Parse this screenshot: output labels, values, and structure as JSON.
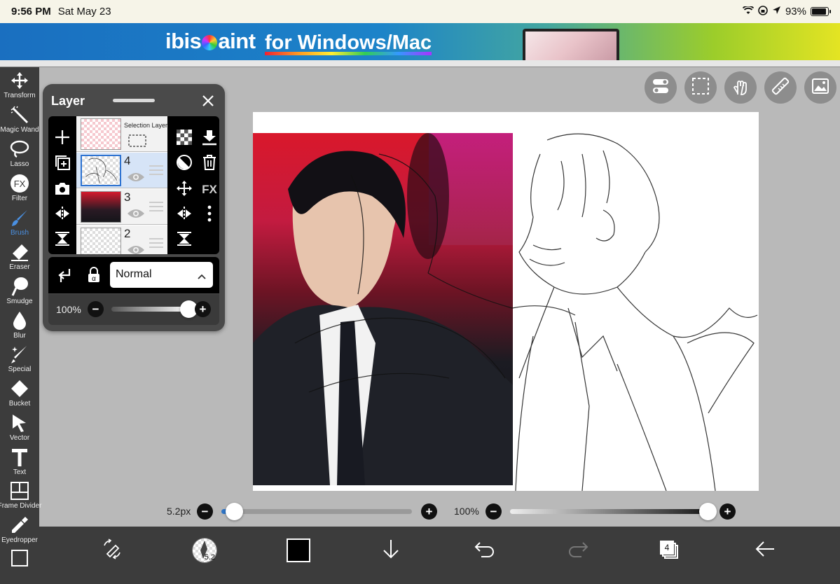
{
  "status_bar": {
    "time": "9:56 PM",
    "date": "Sat May 23",
    "battery": "93%",
    "battery_level": 0.93
  },
  "ad": {
    "brand_pre": "ibis",
    "brand_post": "aint",
    "subtitle": "for Windows/Mac"
  },
  "tools": [
    {
      "label": "Transform",
      "icon": "move-arrows-icon"
    },
    {
      "label": "Magic Wand",
      "icon": "magic-wand-icon"
    },
    {
      "label": "Lasso",
      "icon": "lasso-icon"
    },
    {
      "label": "Filter",
      "icon": "fx-icon"
    },
    {
      "label": "Brush",
      "icon": "brush-icon"
    },
    {
      "label": "Eraser",
      "icon": "eraser-icon"
    },
    {
      "label": "Smudge",
      "icon": "smudge-icon"
    },
    {
      "label": "Blur",
      "icon": "droplet-icon"
    },
    {
      "label": "Special",
      "icon": "special-pen-icon"
    },
    {
      "label": "Bucket",
      "icon": "bucket-icon"
    },
    {
      "label": "Vector",
      "icon": "cursor-arrow-icon"
    },
    {
      "label": "Text",
      "icon": "text-icon"
    },
    {
      "label": "Frame Divider",
      "icon": "frame-divider-icon"
    },
    {
      "label": "Eyedropper",
      "icon": "eyedropper-icon"
    }
  ],
  "active_tool": "Brush",
  "layer_panel": {
    "title": "Layer",
    "fx_label": "FX",
    "layers": [
      {
        "number": "",
        "name": "Selection Layer",
        "selected": false
      },
      {
        "number": "4",
        "name": "",
        "selected": true
      },
      {
        "number": "3",
        "name": "",
        "selected": false
      },
      {
        "number": "2",
        "name": "",
        "selected": false
      }
    ],
    "blend_mode": "Normal",
    "opacity": "100%",
    "opacity_value": 1.0
  },
  "filter_label": "FX",
  "brush_size": {
    "label": "5.2px",
    "value": 5.2,
    "fraction": 0.03
  },
  "brush_opacity": {
    "label": "100%",
    "value": 1.0
  },
  "bottom_bar": {
    "brush_size_badge": "5.2",
    "layer_count": "4",
    "color": "#000000"
  }
}
